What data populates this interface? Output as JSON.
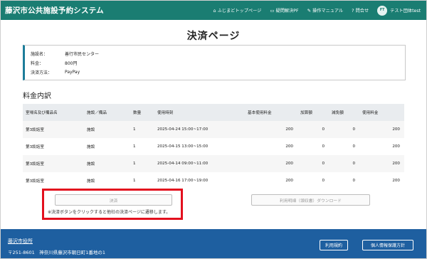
{
  "header": {
    "brand": "藤沢市公共施設予約システム",
    "nav": [
      {
        "icon": "home-icon",
        "glyph": "⌂",
        "label": "ふじまどトップページ"
      },
      {
        "icon": "book-icon",
        "glyph": "▭",
        "label": "疑問解決PF"
      },
      {
        "icon": "pen-icon",
        "glyph": "✎",
        "label": "操作マニュアル"
      },
      {
        "icon": "question-icon",
        "glyph": "?",
        "label": "問合せ"
      }
    ],
    "user": {
      "initials": "FT",
      "name": "テスト団体test"
    }
  },
  "page_title": "決済ページ",
  "info": {
    "facility_label": "施設名：",
    "facility_value": "善行市民センター",
    "fee_label": "料金：",
    "fee_value": "800円",
    "method_label": "決済方法：",
    "method_value": "PayPay"
  },
  "section_title": "料金内訳",
  "table": {
    "headers": [
      "室場名及び備品名",
      "施設／備品",
      "数量",
      "使用時刻",
      "基本使用料金",
      "加算額",
      "減免額",
      "使用料金"
    ],
    "rows": [
      [
        "第3談話室",
        "施設",
        "1",
        "2025-04-24 15:00~17:00",
        "200",
        "0",
        "0",
        "200"
      ],
      [
        "第3談話室",
        "施設",
        "1",
        "2025-04-15 13:00~15:00",
        "200",
        "0",
        "0",
        "200"
      ],
      [
        "第3談話室",
        "施設",
        "1",
        "2025-04-14 09:00~11:00",
        "200",
        "0",
        "0",
        "200"
      ],
      [
        "第3談話室",
        "施設",
        "1",
        "2025-04-16 17:00~19:00",
        "200",
        "0",
        "0",
        "200"
      ]
    ]
  },
  "actions": {
    "settle_label": "決済",
    "settle_note": "※決済ボタンをクリックすると他社の決済ページに遷移します。",
    "receipt_label": "利用明細（領収書）ダウンロード",
    "highlight_color": "#e3101e"
  },
  "footer": {
    "org": "藤沢市役所",
    "address": "〒251-8601　神奈川県藤沢市朝日町1番地の1",
    "terms": "利用規約",
    "privacy": "個人情報保護方針"
  }
}
